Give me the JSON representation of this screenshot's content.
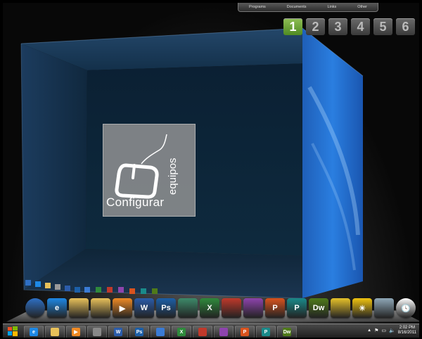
{
  "topbar": {
    "items": [
      "Programs",
      "Documents",
      "Links",
      "Other"
    ]
  },
  "desktops": {
    "items": [
      "1",
      "2",
      "3",
      "4",
      "5",
      "6"
    ],
    "active_index": 0,
    "active_color": "#6aa63a"
  },
  "logo": {
    "word1": "Configurar",
    "word2": "equipos"
  },
  "dock": {
    "items": [
      {
        "icon": "windows-orb-icon",
        "color": "#2e6fc4",
        "text": ""
      },
      {
        "icon": "internet-explorer-icon",
        "color": "#1e88e5",
        "text": "e"
      },
      {
        "icon": "folder-icon",
        "color": "#e8c15a",
        "text": ""
      },
      {
        "icon": "folder-icon",
        "color": "#e8c15a",
        "text": ""
      },
      {
        "icon": "media-player-icon",
        "color": "#f08a24",
        "text": "▶"
      },
      {
        "icon": "word-icon",
        "color": "#2b5caa",
        "text": "W"
      },
      {
        "icon": "photoshop-icon",
        "color": "#1c5fa8",
        "text": "Ps"
      },
      {
        "icon": "blank-app-icon",
        "color": "#3d8a6a",
        "text": ""
      },
      {
        "icon": "excel-icon",
        "color": "#2f8a3c",
        "text": "X"
      },
      {
        "icon": "ccleaner-icon",
        "color": "#c0392b",
        "text": ""
      },
      {
        "icon": "winrar-icon",
        "color": "#8e44ad",
        "text": ""
      },
      {
        "icon": "powerpoint-icon",
        "color": "#d9531e",
        "text": "P"
      },
      {
        "icon": "publisher-icon",
        "color": "#1a8a8a",
        "text": "P"
      },
      {
        "icon": "dreamweaver-icon",
        "color": "#4f7a1a",
        "text": "Dw"
      },
      {
        "icon": "cube-icon",
        "color": "#e6c229",
        "text": ""
      },
      {
        "icon": "weather-icon",
        "color": "#f1c40f",
        "text": "☀"
      },
      {
        "icon": "recycle-bin-icon",
        "color": "#8fa8b8",
        "text": ""
      },
      {
        "icon": "clock-icon",
        "color": "#ffffff",
        "text": "🕓"
      }
    ]
  },
  "taskbar": {
    "items": [
      {
        "icon": "internet-explorer-icon",
        "color": "#1e88e5",
        "text": "e"
      },
      {
        "icon": "folder-icon",
        "color": "#e8c15a",
        "text": ""
      },
      {
        "icon": "media-player-icon",
        "color": "#f08a24",
        "text": "▶"
      },
      {
        "icon": "app-icon",
        "color": "#888888",
        "text": ""
      },
      {
        "icon": "word-icon",
        "color": "#2b5caa",
        "text": "W"
      },
      {
        "icon": "photoshop-icon",
        "color": "#1c5fa8",
        "text": "Ps"
      },
      {
        "icon": "app-icon",
        "color": "#3a7bd5",
        "text": ""
      },
      {
        "icon": "excel-icon",
        "color": "#2f8a3c",
        "text": "X"
      },
      {
        "icon": "ccleaner-icon",
        "color": "#c0392b",
        "text": ""
      },
      {
        "icon": "winrar-icon",
        "color": "#8e44ad",
        "text": ""
      },
      {
        "icon": "powerpoint-icon",
        "color": "#d9531e",
        "text": "P"
      },
      {
        "icon": "publisher-icon",
        "color": "#1a8a8a",
        "text": "P"
      },
      {
        "icon": "dreamweaver-icon",
        "color": "#4f7a1a",
        "text": "Dw"
      }
    ],
    "time": "2:02 PM",
    "date": "8/16/2011"
  }
}
